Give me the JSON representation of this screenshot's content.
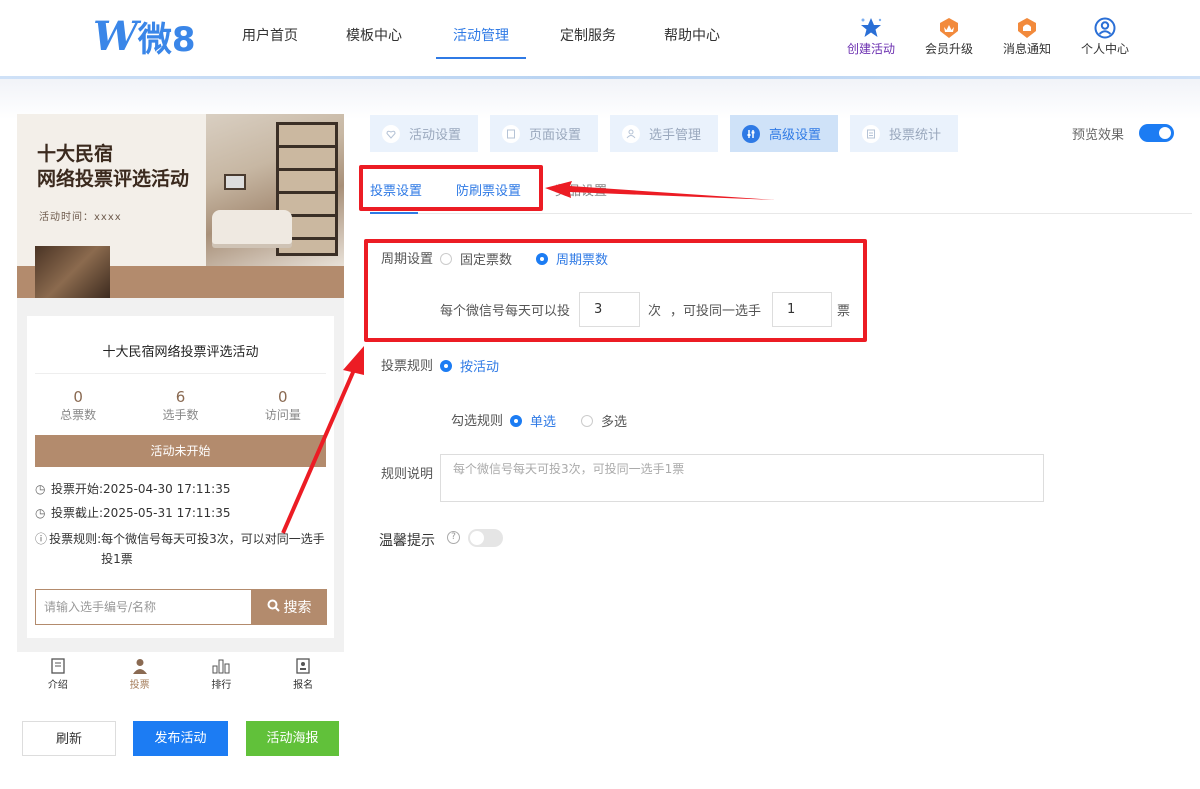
{
  "header": {
    "logo_text": "微8",
    "nav": [
      "用户首页",
      "模板中心",
      "活动管理",
      "定制服务",
      "帮助中心"
    ],
    "active_nav": "活动管理",
    "right_items": [
      {
        "label": "创建活动",
        "icon": "star-icon"
      },
      {
        "label": "会员升级",
        "icon": "crown-badge-icon"
      },
      {
        "label": "消息通知",
        "icon": "bell-badge-icon"
      },
      {
        "label": "个人中心",
        "icon": "user-circle-icon"
      }
    ]
  },
  "preview": {
    "banner_title_line1": "十大民宿",
    "banner_title_line2": "网络投票评选活动",
    "banner_time": "活动时间：xxxx",
    "card_title": "十大民宿网络投票评选活动",
    "stats": [
      {
        "value": "0",
        "label": "总票数"
      },
      {
        "value": "6",
        "label": "选手数"
      },
      {
        "value": "0",
        "label": "访问量"
      }
    ],
    "status": "活动未开始",
    "vote_start_label": "投票开始:",
    "vote_start": "2025-04-30 17:11:35",
    "vote_end_label": "投票截止:",
    "vote_end": "2025-05-31 17:11:35",
    "vote_rule_label": "投票规则:",
    "vote_rule": "每个微信号每天可投3次，可以对同一选手投1票",
    "search_placeholder": "请输入选手编号/名称",
    "search_button": "搜索",
    "tabs": [
      "介绍",
      "投票",
      "排行",
      "报名"
    ],
    "active_tab": "投票"
  },
  "actions": {
    "refresh": "刷新",
    "publish": "发布活动",
    "poster": "活动海报"
  },
  "steps": [
    "活动设置",
    "页面设置",
    "选手管理",
    "高级设置",
    "投票统计"
  ],
  "active_step": "高级设置",
  "preview_toggle_label": "预览效果",
  "sub_tabs": [
    "投票设置",
    "防刷票设置",
    "奖品设置"
  ],
  "form": {
    "cycle_label": "周期设置",
    "cycle_options": [
      "固定票数",
      "周期票数"
    ],
    "cycle_selected": "周期票数",
    "daily_text": "每个微信号每天可以投",
    "daily_value": "3",
    "times_unit": "次",
    "same_player_text": "，可投同一选手",
    "same_player_value": "1",
    "votes_unit": "票",
    "rule_label": "投票规则",
    "rule_option": "按活动",
    "select_rule_label": "勾选规则",
    "select_options": [
      "单选",
      "多选"
    ],
    "select_selected": "单选",
    "rule_desc_label": "规则说明",
    "rule_desc_placeholder": "每个微信号每天可投3次，可投同一选手1票",
    "tip_label": "温馨提示"
  },
  "colors": {
    "accent": "#2f7ae5",
    "brand_brown": "#b38b6d",
    "publish": "#1c7cf3",
    "poster": "#61c13a",
    "annotation": "#ec1c24"
  }
}
